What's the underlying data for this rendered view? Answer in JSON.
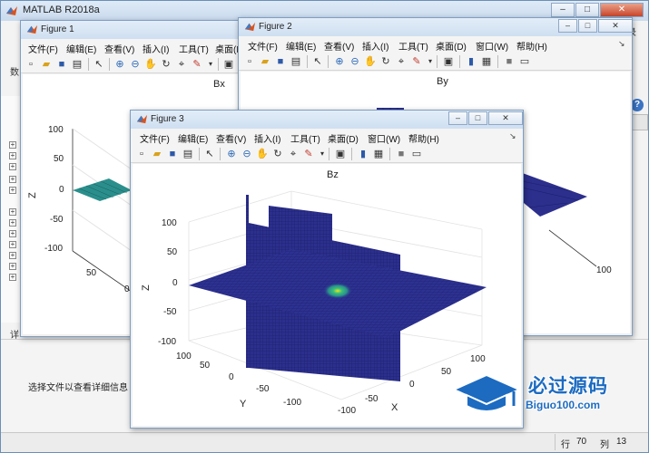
{
  "main_window": {
    "title": "MATLAB R2018a",
    "login_label": "录",
    "help_label": "?",
    "side_chars": [
      "数",
      "详"
    ],
    "detail_text": "选择文件以查看详细信息",
    "status": {
      "row_label": "行",
      "row_value": "70",
      "col_label": "列",
      "col_value": "13"
    }
  },
  "figure_menu": [
    "文件(F)",
    "编辑(E)",
    "查看(V)",
    "插入(I)",
    "工具(T)",
    "桌面(D)",
    "窗口(W)",
    "帮助(H)"
  ],
  "figure1": {
    "title": "Figure 1",
    "plot_title": "Bx",
    "z_label": "Z",
    "z_ticks": [
      "100",
      "50",
      "0",
      "-50",
      "-100"
    ],
    "y_ticks": [
      "50",
      "0"
    ]
  },
  "figure2": {
    "title": "Figure 2",
    "plot_title": "By",
    "x_ticks": [
      "100"
    ]
  },
  "figure3": {
    "title": "Figure 3",
    "plot_title": "Bz",
    "z_label": "Z",
    "y_label": "Y",
    "x_label": "X",
    "z_ticks": [
      "100",
      "50",
      "0",
      "-50",
      "-100"
    ],
    "y_ticks": [
      "100",
      "50",
      "0",
      "-50",
      "-100"
    ],
    "x_ticks": [
      "-100",
      "-50",
      "0",
      "50",
      "100"
    ]
  },
  "icons": [
    "matlab-logo",
    "new-icon",
    "open-icon",
    "save-icon",
    "print-icon",
    "pointer-icon",
    "zoom-in-icon",
    "zoom-out-icon",
    "pan-icon",
    "rotate-icon",
    "data-cursor-icon",
    "brush-icon",
    "link-icon",
    "colorbar-icon",
    "legend-icon",
    "hide-tools-icon",
    "show-tools-icon"
  ],
  "colors": {
    "plane": "#2c2f8c",
    "plane_grid": "#17195e",
    "highlight": "#f5e11b",
    "accent": "#1c6bc1"
  },
  "watermark": {
    "name": "必过源码",
    "url": "Biguo100.com"
  }
}
